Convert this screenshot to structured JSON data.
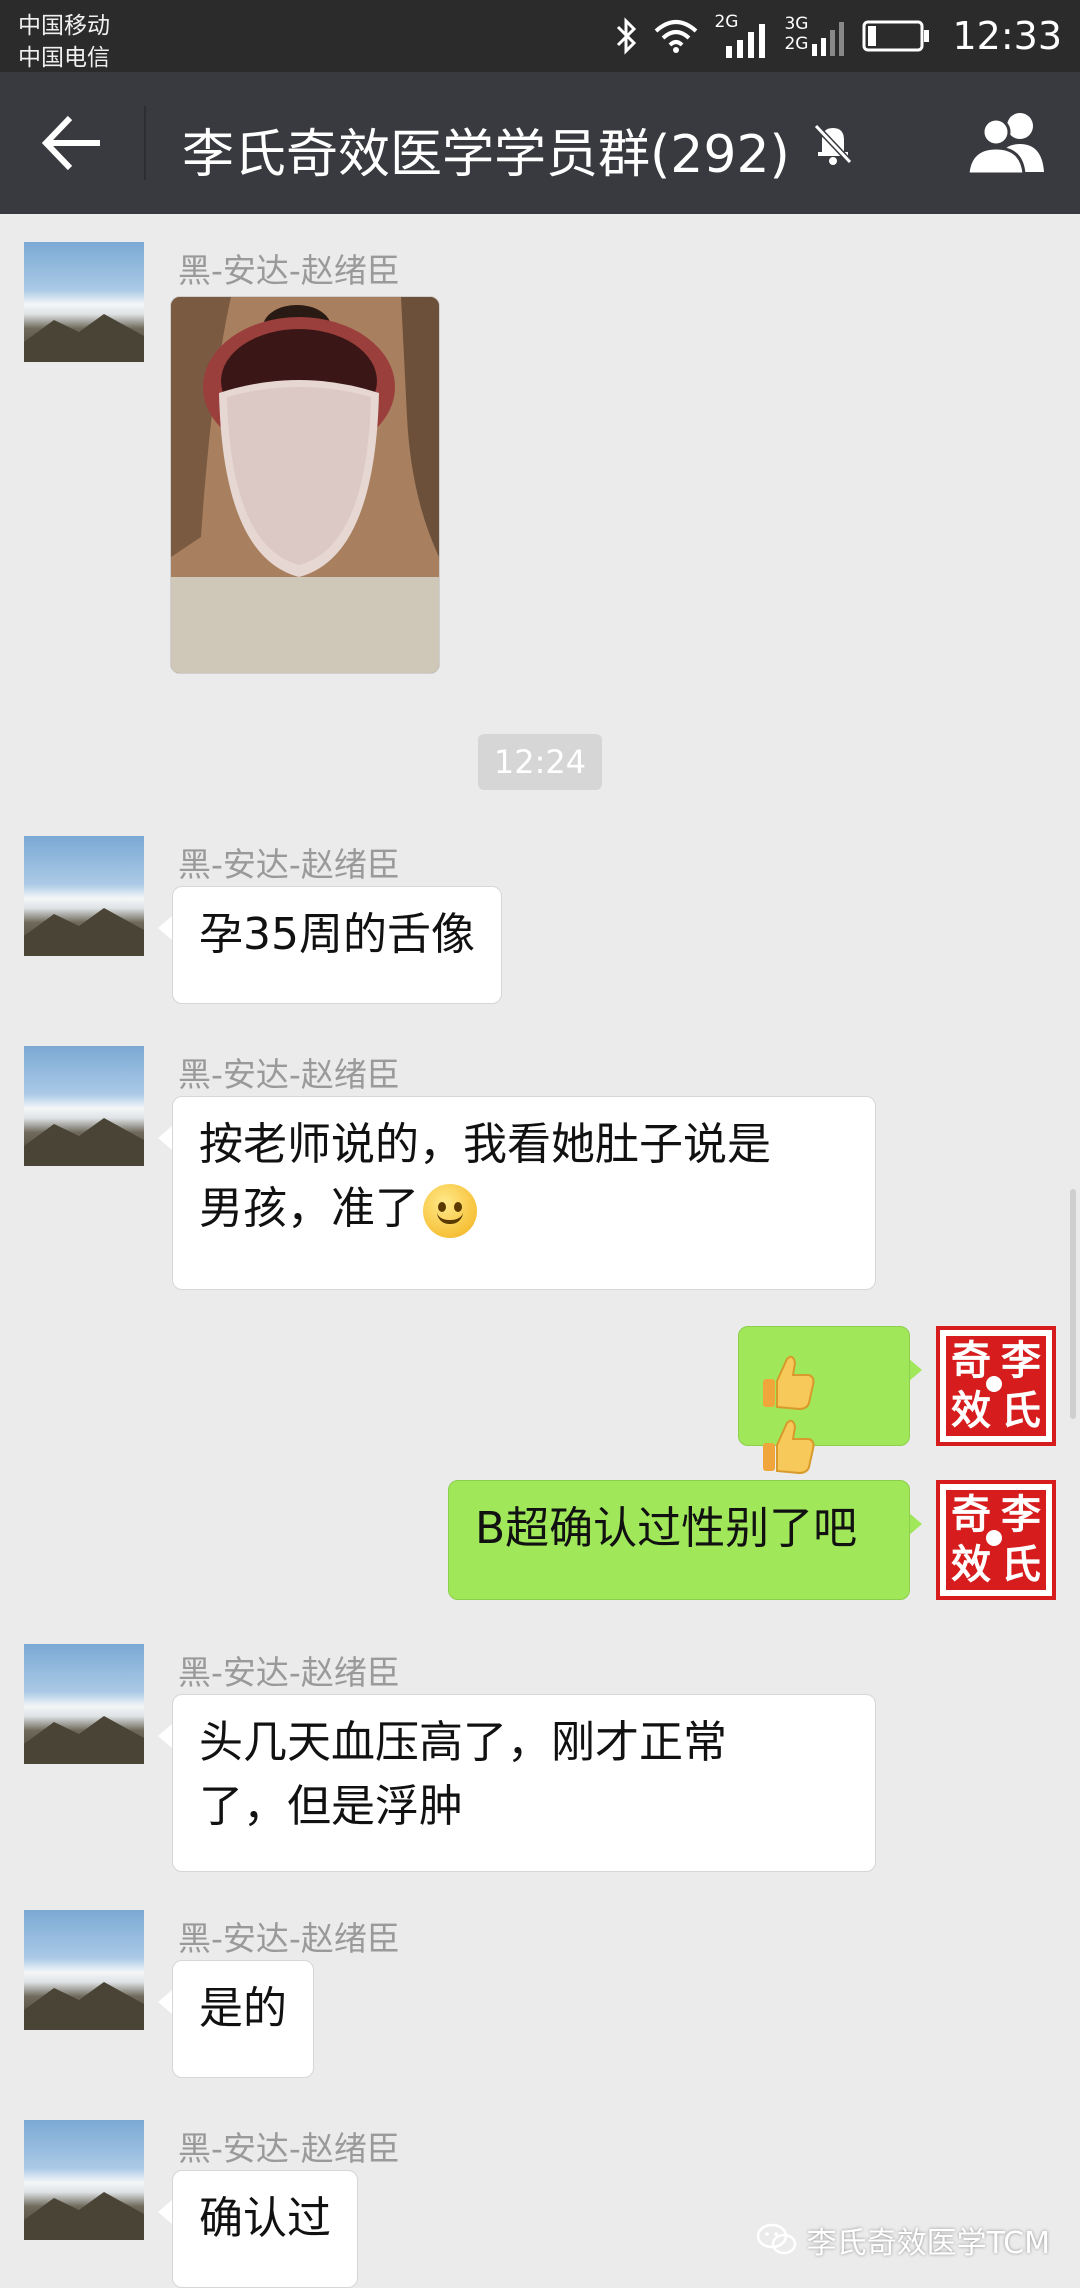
{
  "status_bar": {
    "carrier_1": "中国移动",
    "carrier_2": "中国电信",
    "net_1": "2G",
    "net_2_top": "3G",
    "net_2_bottom": "2G",
    "time": "12:33"
  },
  "header": {
    "title": "李氏奇效医学学员群(292)",
    "muted": true
  },
  "messages": [
    {
      "sender": "黑-安达-赵绪臣",
      "type": "image",
      "content_desc": "tongue-photo"
    },
    {
      "type": "timestamp",
      "text": "12:24"
    },
    {
      "sender": "黑-安达-赵绪臣",
      "type": "text",
      "text": "孕35周的舌像"
    },
    {
      "sender": "黑-安达-赵绪臣",
      "type": "text",
      "line1": "按老师说的，我看她肚子说是",
      "line2": "男孩，准了",
      "emoji": "smile"
    },
    {
      "sender": "self",
      "type": "emoji",
      "emoji": "thumbs-up-x2"
    },
    {
      "sender": "self",
      "type": "text",
      "text": "B超确认过性别了吧"
    },
    {
      "sender": "黑-安达-赵绪臣",
      "type": "text",
      "line1": "头几天血压高了，刚才正常",
      "line2": "了，但是浮肿"
    },
    {
      "sender": "黑-安达-赵绪臣",
      "type": "text",
      "text": "是的"
    },
    {
      "sender": "黑-安达-赵绪臣",
      "type": "text",
      "text": "确认过"
    }
  ],
  "seal": {
    "c1": "奇",
    "c2": "李",
    "c3": "效",
    "c4": "氏"
  },
  "watermark": "李氏奇效医学TCM",
  "colors": {
    "titlebar": "#393a3f",
    "self_bubble": "#a0e75a",
    "background": "#ebebeb",
    "seal_red": "#d61c1c"
  }
}
